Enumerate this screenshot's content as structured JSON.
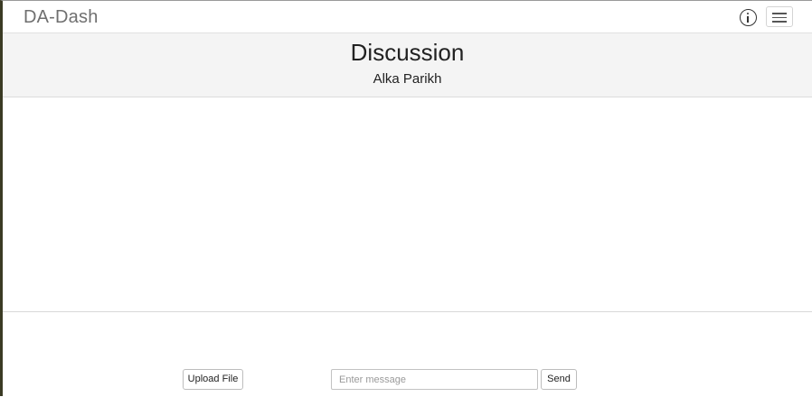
{
  "navbar": {
    "brand": "DA-Dash",
    "info_icon": "info-circle-icon",
    "menu_icon": "hamburger-menu-icon"
  },
  "header": {
    "title": "Discussion",
    "participant": "Alka Parikh"
  },
  "messages": [],
  "composer": {
    "upload_label": "Upload File",
    "message_value": "",
    "message_placeholder": "Enter message",
    "send_label": "Send"
  },
  "colors": {
    "header_background": "#f4f4f4",
    "brand_text": "#6f6f6f",
    "left_edge_border": "#3b3b24"
  }
}
